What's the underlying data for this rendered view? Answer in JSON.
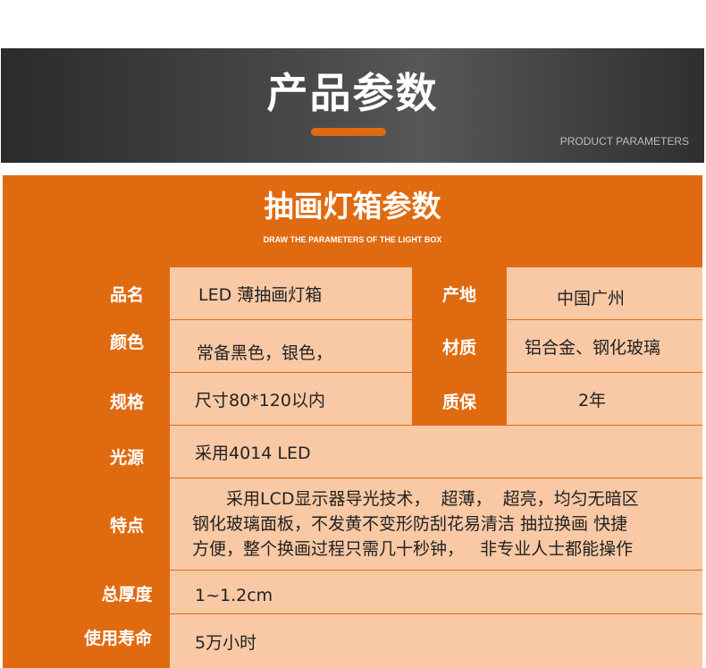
{
  "banner": {
    "title": "产品参数",
    "subtitle": "PRODUCT PARAMETERS"
  },
  "panel": {
    "title": "抽画灯箱参数",
    "subtitle": "DRAW THE PARAMETERS OF THE LIGHT BOX"
  },
  "rows": {
    "name": {
      "label": "品名",
      "value": "LED  薄抽画灯箱"
    },
    "origin": {
      "label": "产地",
      "value": "中国广州"
    },
    "color": {
      "label": "颜色",
      "value": "常备黑色，银色，"
    },
    "material": {
      "label": "材质",
      "value": "铝合金、钢化玻璃"
    },
    "size": {
      "label": "规格",
      "value": "尺寸80*120以内"
    },
    "warranty": {
      "label": "质保",
      "value": "2年"
    },
    "light": {
      "label": "光源",
      "value": "采用4014 LED"
    },
    "features": {
      "label": "特点",
      "lines": [
        "　　采用LCD显示器导光技术，  超薄，  超亮，均匀无暗区",
        "钢化玻璃面板，不发黄不变形防刮花易清洁 抽拉换画 快捷",
        "方便，整个换画过程只需几十秒钟，   非专业人士都能操作"
      ]
    },
    "thickness": {
      "label": "总厚度",
      "value": "1~1.2cm"
    },
    "lifespan": {
      "label": "使用寿命",
      "value": "5万小时"
    }
  },
  "colors": {
    "accent": "#e06a10",
    "cell_fill": "#f9c9a5",
    "banner_dark": "#2b2b2b"
  }
}
